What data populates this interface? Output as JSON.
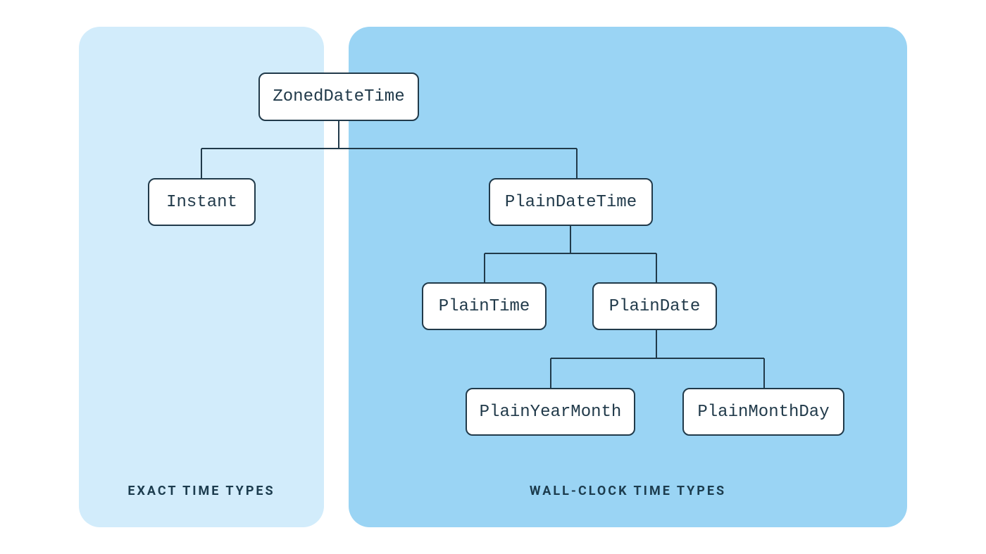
{
  "colors": {
    "panel_left_bg": "#d2ecfb",
    "panel_right_bg": "#9ad4f4",
    "node_border": "#213a4a",
    "node_bg": "#ffffff",
    "text": "#213a4a"
  },
  "categories": {
    "left": "EXACT TIME TYPES",
    "right": "WALL-CLOCK TIME TYPES"
  },
  "nodes": {
    "zonedDateTime": "ZonedDateTime",
    "instant": "Instant",
    "plainDateTime": "PlainDateTime",
    "plainTime": "PlainTime",
    "plainDate": "PlainDate",
    "plainYearMonth": "PlainYearMonth",
    "plainMonthDay": "PlainMonthDay"
  },
  "hierarchy": {
    "ZonedDateTime": [
      "Instant",
      "PlainDateTime"
    ],
    "PlainDateTime": [
      "PlainTime",
      "PlainDate"
    ],
    "PlainDate": [
      "PlainYearMonth",
      "PlainMonthDay"
    ]
  }
}
